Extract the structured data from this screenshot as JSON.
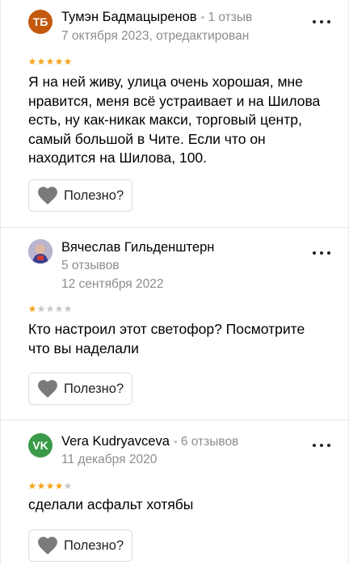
{
  "reviews": [
    {
      "author": "Тумэн Бадмацыренов",
      "initials": "ТБ",
      "avatar_color": "#c4580f",
      "review_count": "1 отзыв",
      "date": "7 октября 2023, отредактирован",
      "rating": 5,
      "text": "Я на ней живу, улица очень хорошая, мне нравится, меня всё устраивает и на Шилова есть, ну как-никак макси, торговый центр, самый большой в Чите. Если что он находится на Шилова, 100.",
      "useful_label": "Полезно?",
      "more_icon": "more-dots-icon"
    },
    {
      "author": "Вячеслав Гильденштерн",
      "initials": "",
      "avatar_color": "#6b5b95",
      "review_count": "5 отзывов",
      "date": "12 сентября 2022",
      "rating": 1,
      "text": "Кто настроил этот светофор? Посмотрите что вы наделали",
      "useful_label": "Полезно?",
      "more_icon": "more-dots-icon"
    },
    {
      "author": "Vera Kudryavceva",
      "initials": "VK",
      "avatar_color": "#3a9a48",
      "review_count": "6 отзывов",
      "date": "11 декабря 2020",
      "rating": 4,
      "text": "сделали асфальт хотябы",
      "useful_label": "Полезно?",
      "more_icon": "more-dots-icon"
    }
  ],
  "colors": {
    "star_filled": "#f5a623",
    "star_empty": "#c8c8c8",
    "heart": "#7a7a7a"
  }
}
